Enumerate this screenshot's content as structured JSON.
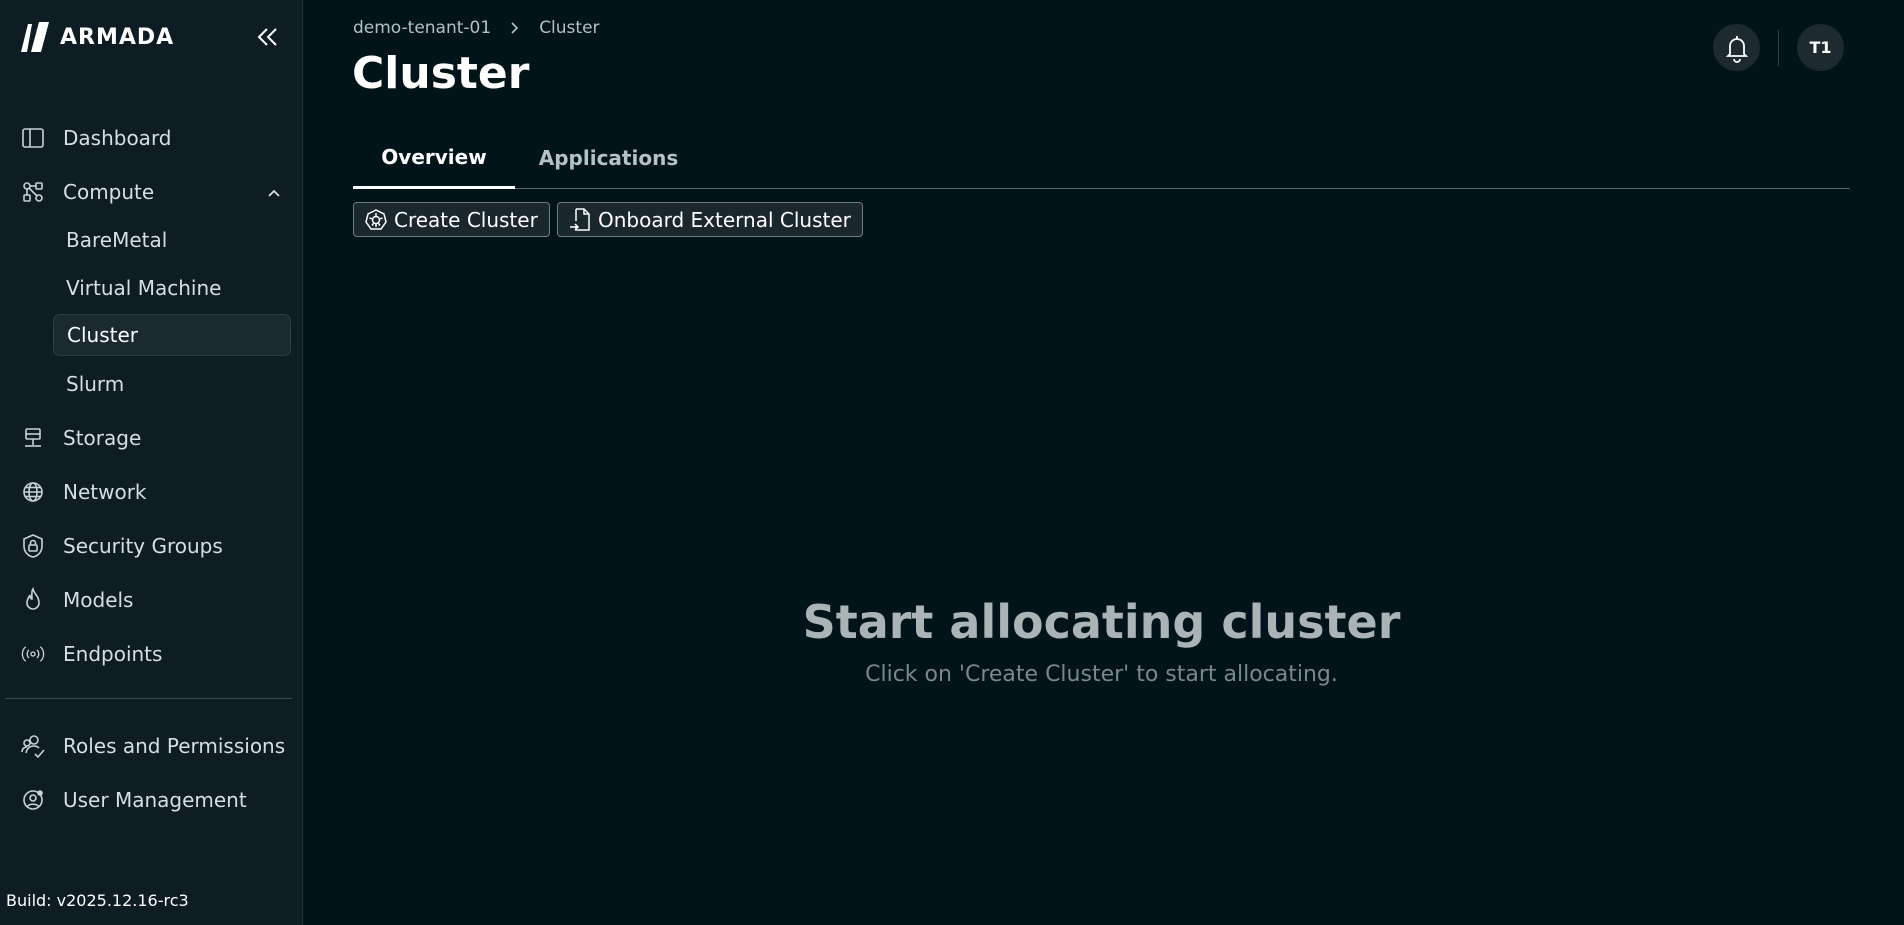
{
  "brand": {
    "name": "ARMADA"
  },
  "sidebar": {
    "items": [
      {
        "label": "Dashboard",
        "icon": "sidebar-panel-icon"
      },
      {
        "label": "Compute",
        "icon": "compute-nodes-icon",
        "expanded": true,
        "children": [
          {
            "label": "BareMetal"
          },
          {
            "label": "Virtual Machine"
          },
          {
            "label": "Cluster",
            "active": true
          },
          {
            "label": "Slurm"
          }
        ]
      },
      {
        "label": "Storage",
        "icon": "storage-icon"
      },
      {
        "label": "Network",
        "icon": "globe-icon"
      },
      {
        "label": "Security Groups",
        "icon": "shield-lock-icon"
      },
      {
        "label": "Models",
        "icon": "flame-icon"
      },
      {
        "label": "Endpoints",
        "icon": "broadcast-icon"
      }
    ],
    "bottom_items": [
      {
        "label": "Roles and Permissions",
        "icon": "users-check-icon"
      },
      {
        "label": "User Management",
        "icon": "user-gear-icon"
      }
    ],
    "build": "Build: v2025.12.16-rc3"
  },
  "header": {
    "breadcrumb": [
      "demo-tenant-01",
      "Cluster"
    ],
    "title": "Cluster",
    "avatar_initials": "T1"
  },
  "tabs": [
    {
      "label": "Overview",
      "active": true
    },
    {
      "label": "Applications",
      "active": false
    }
  ],
  "actions": {
    "create_cluster": "Create Cluster",
    "onboard_external": "Onboard External Cluster"
  },
  "empty_state": {
    "title": "Start allocating cluster",
    "subtitle": "Click on 'Create Cluster' to start allocating."
  }
}
